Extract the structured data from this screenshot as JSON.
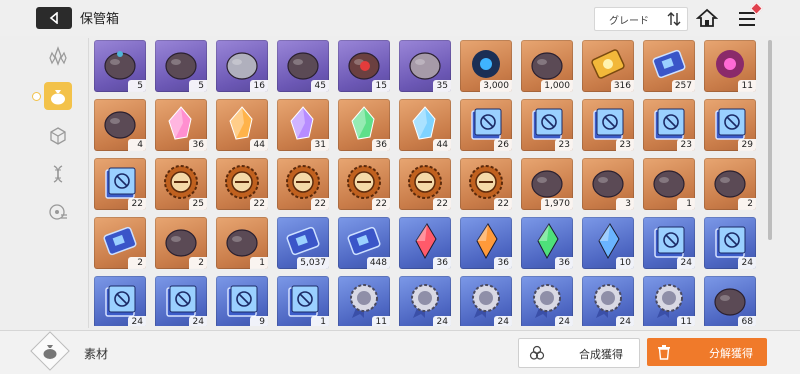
{
  "header": {
    "title": "保管箱",
    "sort_label": "グレード",
    "back_icon": "back-arrow-icon",
    "home_icon": "home-icon",
    "menu_icon": "hamburger-menu-icon"
  },
  "sidebar": {
    "tabs": [
      {
        "icon": "crystal-cluster-icon",
        "active": false
      },
      {
        "icon": "material-bag-icon",
        "active": true
      },
      {
        "icon": "cube-icon",
        "active": false
      },
      {
        "icon": "dna-icon",
        "active": false
      },
      {
        "icon": "disc-list-icon",
        "active": false
      }
    ]
  },
  "inventory": {
    "items": [
      {
        "name": "purple-stone-head",
        "rarity": "purple",
        "qty": "5"
      },
      {
        "name": "purple-dark-ore",
        "rarity": "purple",
        "qty": "5"
      },
      {
        "name": "purple-silver-orb",
        "rarity": "purple",
        "qty": "16"
      },
      {
        "name": "purple-rock-face",
        "rarity": "purple",
        "qty": "45"
      },
      {
        "name": "purple-red-core-rock",
        "rarity": "purple",
        "qty": "15"
      },
      {
        "name": "purple-spiral-shell",
        "rarity": "purple",
        "qty": "35"
      },
      {
        "name": "orange-blue-eye-orb",
        "rarity": "orange",
        "qty": "3,000"
      },
      {
        "name": "orange-dark-chip",
        "rarity": "orange",
        "qty": "1,000"
      },
      {
        "name": "orange-gold-ticket",
        "rarity": "orange",
        "qty": "316"
      },
      {
        "name": "orange-gold-card",
        "rarity": "orange",
        "qty": "257"
      },
      {
        "name": "orange-purple-eye",
        "rarity": "orange",
        "qty": "11"
      },
      {
        "name": "orange-golden-feather",
        "rarity": "orange",
        "qty": "4"
      },
      {
        "name": "orange-rainbow-crystal",
        "rarity": "orange",
        "qty": "36"
      },
      {
        "name": "orange-orange-crystal",
        "rarity": "orange",
        "qty": "44"
      },
      {
        "name": "orange-purple-crystal",
        "rarity": "orange",
        "qty": "31"
      },
      {
        "name": "orange-green-crystal",
        "rarity": "orange",
        "qty": "36"
      },
      {
        "name": "orange-blue-crystal",
        "rarity": "orange",
        "qty": "44"
      },
      {
        "name": "orange-book-cross",
        "rarity": "orange",
        "qty": "26"
      },
      {
        "name": "orange-book-shield",
        "rarity": "orange",
        "qty": "23"
      },
      {
        "name": "orange-book-eye",
        "rarity": "orange",
        "qty": "23"
      },
      {
        "name": "orange-book-arrows",
        "rarity": "orange",
        "qty": "23"
      },
      {
        "name": "orange-book-circle",
        "rarity": "orange",
        "qty": "29"
      },
      {
        "name": "orange-book-tome",
        "rarity": "orange",
        "qty": "22"
      },
      {
        "name": "orange-gear-medal-1",
        "rarity": "orange",
        "qty": "25"
      },
      {
        "name": "orange-gear-medal-2",
        "rarity": "orange",
        "qty": "22"
      },
      {
        "name": "orange-gear-medal-3",
        "rarity": "orange",
        "qty": "22"
      },
      {
        "name": "orange-gear-medal-4",
        "rarity": "orange",
        "qty": "22"
      },
      {
        "name": "orange-gear-medal-5",
        "rarity": "orange",
        "qty": "22"
      },
      {
        "name": "orange-gear-medal-6",
        "rarity": "orange",
        "qty": "22"
      },
      {
        "name": "orange-green-sprout",
        "rarity": "orange",
        "qty": "1,970"
      },
      {
        "name": "orange-blue-cube",
        "rarity": "orange",
        "qty": "3"
      },
      {
        "name": "orange-blue-album",
        "rarity": "orange",
        "qty": "1"
      },
      {
        "name": "orange-spray-gun",
        "rarity": "orange",
        "qty": "2"
      },
      {
        "name": "orange-cards",
        "rarity": "orange",
        "qty": "2"
      },
      {
        "name": "orange-dreamcatcher",
        "rarity": "orange",
        "qty": "2"
      },
      {
        "name": "orange-holo-pick",
        "rarity": "orange",
        "qty": "1"
      },
      {
        "name": "blue-card-chip",
        "rarity": "blue",
        "qty": "5,037"
      },
      {
        "name": "blue-card-key",
        "rarity": "blue",
        "qty": "448"
      },
      {
        "name": "blue-red-shard",
        "rarity": "blue",
        "qty": "36"
      },
      {
        "name": "blue-orange-shard",
        "rarity": "blue",
        "qty": "36"
      },
      {
        "name": "blue-green-shard",
        "rarity": "blue",
        "qty": "36"
      },
      {
        "name": "blue-blue-shard",
        "rarity": "blue",
        "qty": "10"
      },
      {
        "name": "blue-book-cross",
        "rarity": "blue",
        "qty": "24"
      },
      {
        "name": "blue-book-shield",
        "rarity": "blue",
        "qty": "24"
      },
      {
        "name": "blue-book-eye",
        "rarity": "blue",
        "qty": "24"
      },
      {
        "name": "blue-book-arrows",
        "rarity": "blue",
        "qty": "24"
      },
      {
        "name": "blue-book-circle",
        "rarity": "blue",
        "qty": "9"
      },
      {
        "name": "blue-book-tome",
        "rarity": "blue",
        "qty": "1"
      },
      {
        "name": "blue-silver-medal-1",
        "rarity": "blue",
        "qty": "11"
      },
      {
        "name": "blue-silver-medal-2",
        "rarity": "blue",
        "qty": "24"
      },
      {
        "name": "blue-silver-medal-3",
        "rarity": "blue",
        "qty": "24"
      },
      {
        "name": "blue-silver-medal-4",
        "rarity": "blue",
        "qty": "24"
      },
      {
        "name": "blue-silver-medal-5",
        "rarity": "blue",
        "qty": "24"
      },
      {
        "name": "blue-silver-medal-6",
        "rarity": "blue",
        "qty": "11"
      },
      {
        "name": "blue-crystal-sprout",
        "rarity": "blue",
        "qty": "68"
      }
    ]
  },
  "footer": {
    "category_label": "素材",
    "synthesize_label": "合成獲得",
    "dismantle_label": "分解獲得"
  },
  "colors": {
    "accent_orange": "#f07a2a",
    "active_tab_yellow": "#f3c24a",
    "rarity_purple": "#7b66c4",
    "rarity_orange": "#d38a55",
    "rarity_blue": "#5a73cc",
    "badge_red": "#e0404c"
  }
}
